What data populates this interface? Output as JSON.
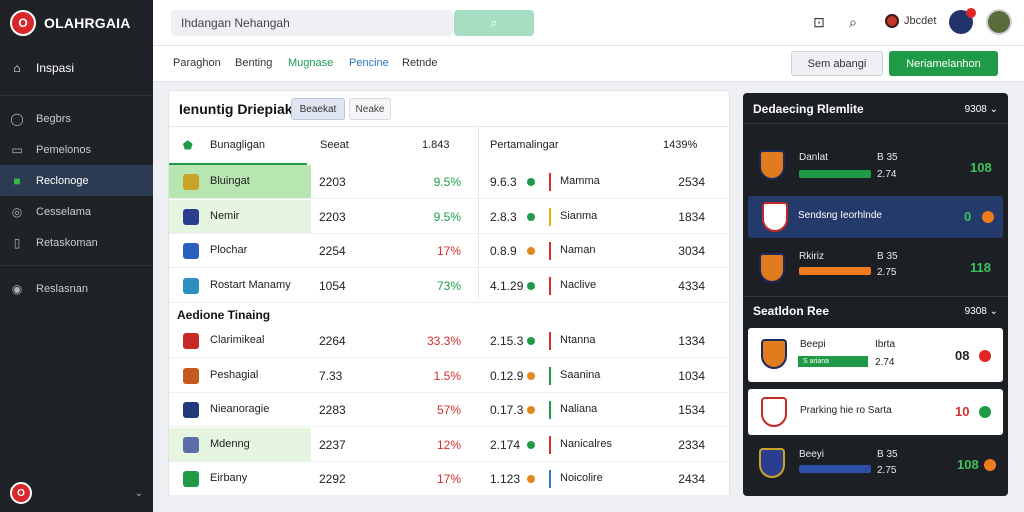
{
  "app": {
    "title": "OLAHRGAIA"
  },
  "sidebar": {
    "items": [
      {
        "label": "Inspasi",
        "icon": "home-icon"
      },
      {
        "label": "Begbrs",
        "icon": "grid-icon"
      },
      {
        "label": "Pemelonos",
        "icon": "chart-icon"
      },
      {
        "label": "Reclonoge",
        "icon": "calendar-icon"
      },
      {
        "label": "Cesselama",
        "icon": "clock-icon"
      },
      {
        "label": "Retaskoman",
        "icon": "document-icon"
      },
      {
        "label": "Reslasnan",
        "icon": "globe-icon"
      }
    ]
  },
  "search": {
    "value": "Ihdangan Nehangah"
  },
  "topbar": {
    "user_name": "Jbcdet"
  },
  "tabs": [
    "Paraghon",
    "Benting",
    "Mugnase",
    "Pencine",
    "Retnde"
  ],
  "buttons": {
    "secondary": "Sem abangi",
    "primary": "Neriamelanhon"
  },
  "standings": {
    "title": "Ienuntig Driepiak",
    "pill1": "Beaekat",
    "pill2": "Neake",
    "headers": {
      "team": "Bunagligan",
      "value": "Seeat",
      "pct": "1.843",
      "matches": "Pertamalingar",
      "right": "1439%"
    },
    "rows": [
      {
        "team": "Bluingat",
        "value": "2203",
        "pct": "9.5%",
        "score": "9.6.3",
        "status": "Mamma",
        "num": "2534",
        "crest": "#c9a227",
        "dot": "#1f9b48",
        "bar": "#d32f2f",
        "pct_color": "green",
        "highlight": "#b8e6b0"
      },
      {
        "team": "Nemir",
        "value": "2203",
        "pct": "9.5%",
        "score": "2.8.3",
        "status": "Sianma",
        "num": "1834",
        "crest": "#2a3d8f",
        "dot": "#1f9b48",
        "bar": "#e6b400",
        "pct_color": "green",
        "highlight": "#e6f5df"
      },
      {
        "team": "Plochar",
        "value": "2254",
        "pct": "17%",
        "score": "0.8.9",
        "status": "Naman",
        "num": "3034",
        "crest": "#2b5fbf",
        "dot": "#e08a1e",
        "bar": "#d32f2f",
        "pct_color": "red",
        "highlight": ""
      },
      {
        "team": "Rostart Manamy",
        "value": "1054",
        "pct": "73%",
        "score": "4.1.29",
        "status": "Naclive",
        "num": "4334",
        "crest": "#2b8fbf",
        "dot": "#1f9b48",
        "bar": "#d32f2f",
        "pct_color": "green",
        "highlight": ""
      }
    ],
    "section2_title": "Aedione Tinaing",
    "rows2": [
      {
        "team": "Clarimikeal",
        "value": "2264",
        "pct": "33.3%",
        "score": "2.15.3",
        "status": "Ntanna",
        "num": "1334",
        "crest": "#c62828",
        "dot": "#1f9b48",
        "bar": "#d32f2f",
        "pct_color": "red",
        "highlight": ""
      },
      {
        "team": "Peshagial",
        "value": "7.33",
        "pct": "1.5%",
        "score": "0.12.9",
        "status": "Saanina",
        "num": "1034",
        "crest": "#c45a1e",
        "dot": "#e08a1e",
        "bar": "#1f9b48",
        "pct_color": "red",
        "highlight": ""
      },
      {
        "team": "Nieanoragie",
        "value": "2283",
        "pct": "57%",
        "score": "0.17.3",
        "status": "Naliana",
        "num": "1534",
        "crest": "#1f3a7a",
        "dot": "#e08a1e",
        "bar": "#1f9b48",
        "pct_color": "red",
        "highlight": ""
      },
      {
        "team": "Mdenng",
        "value": "2237",
        "pct": "12%",
        "score": "2.174",
        "status": "Nanicalres",
        "num": "2334",
        "crest": "#5b6ea8",
        "dot": "#1f9b48",
        "bar": "#d32f2f",
        "pct_color": "red",
        "highlight": "#e6f5df"
      },
      {
        "team": "Eirbany",
        "value": "2292",
        "pct": "17%",
        "score": "1.123",
        "status": "Noicolire",
        "num": "2434",
        "crest": "#1f9b48",
        "dot": "#e08a1e",
        "bar": "#2a78c6",
        "pct_color": "red",
        "highlight": ""
      }
    ]
  },
  "live": {
    "title": "Dedaecing Rlemlite",
    "meta": "9308",
    "matches": [
      {
        "name": "Danlat",
        "sub": "2.74",
        "side": "B 35",
        "score": "108",
        "bar": "#1f9b48"
      },
      {
        "name": "Sendsng Ieorhlnde",
        "score": "0",
        "highlighted": true
      },
      {
        "name": "Rkiriz",
        "sub": "2.75",
        "side": "B 35",
        "score": "118",
        "bar": "#f07a1e"
      }
    ],
    "section2_title": "Seatldon Ree",
    "section2_meta": "9308",
    "matches2": [
      {
        "name": "Beepi",
        "sub": "2.74",
        "side": "Ibrta",
        "score": "08",
        "tag": "S ariana"
      },
      {
        "name": "Prarking hie ro Sarta",
        "score": "10"
      },
      {
        "name": "Beeyi",
        "sub": "2.75",
        "side": "B 35",
        "score": "108",
        "bar": "#2d4fa8"
      }
    ]
  }
}
